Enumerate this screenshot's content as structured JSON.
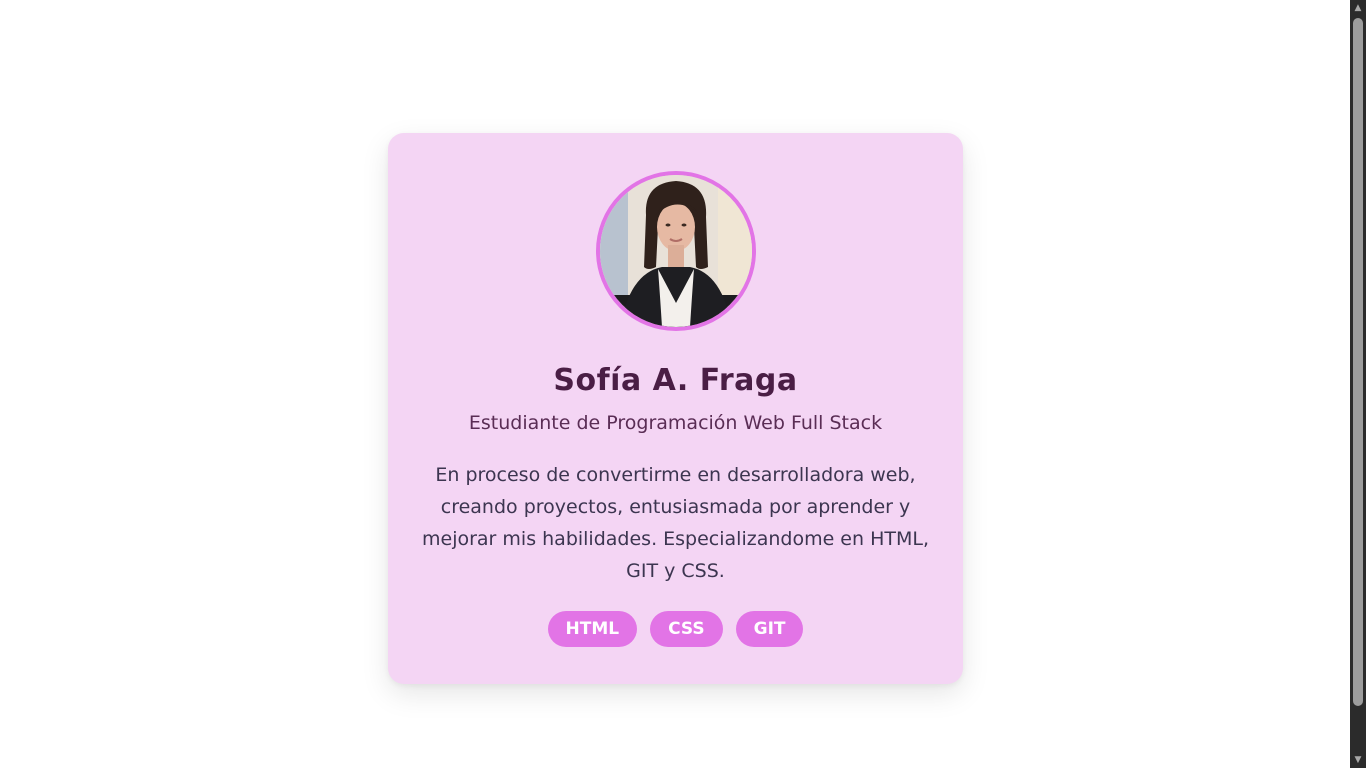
{
  "profile": {
    "photo_alt": "Sofía A. Fraga",
    "name": "Sofía A. Fraga",
    "role": "Estudiante de Programación Web Full Stack",
    "bio": "En proceso de convertirme en desarrolladora web, creando proyectos, entusiasmada por aprender y mejorar mis habilidades. Especializandome en HTML, GIT y CSS."
  },
  "tags": [
    "HTML",
    "CSS",
    "GIT"
  ],
  "colors": {
    "card_background": "#f4d5f4",
    "accent": "#e274e6",
    "name_text": "#4a1e45",
    "body_text": "#3c3550"
  },
  "scrollbar": {
    "up_icon": "triangle-up-icon",
    "down_icon": "triangle-down-icon"
  }
}
